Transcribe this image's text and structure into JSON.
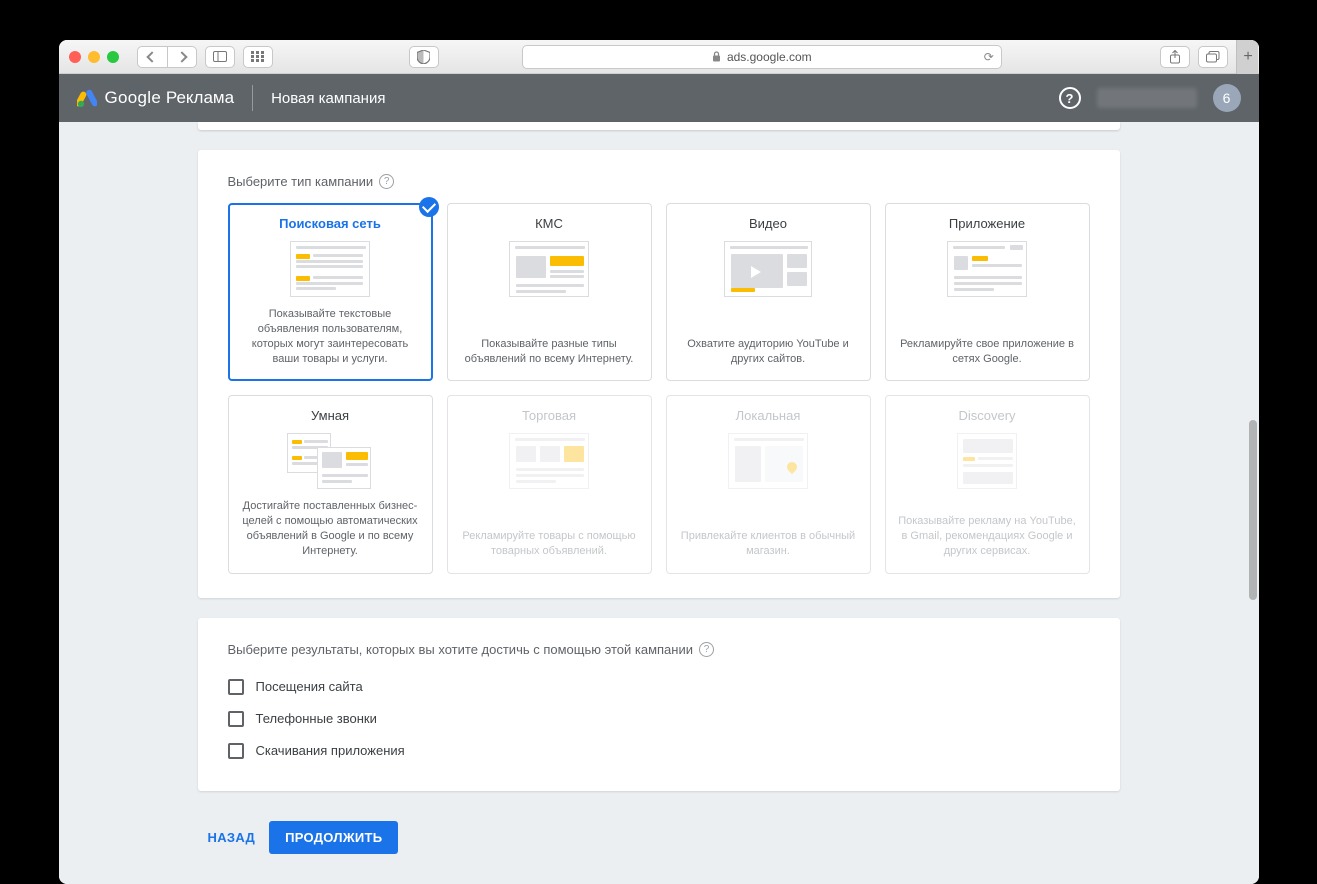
{
  "browser": {
    "url": "ads.google.com"
  },
  "header": {
    "brand": "Google",
    "brand_sub": "Реклама",
    "page": "Новая кампания",
    "avatar": "6"
  },
  "campaign_types": {
    "label": "Выберите тип кампании",
    "items": [
      {
        "title": "Поисковая сеть",
        "desc": "Показывайте текстовые объявления пользователям, которых могут заинтересовать ваши товары и услуги."
      },
      {
        "title": "КМС",
        "desc": "Показывайте разные типы объявлений по всему Интернету."
      },
      {
        "title": "Видео",
        "desc": "Охватите аудиторию YouTube и других сайтов."
      },
      {
        "title": "Приложение",
        "desc": "Рекламируйте свое приложение в сетях Google."
      },
      {
        "title": "Умная",
        "desc": "Достигайте поставленных бизнес-целей с помощью автоматических объявлений в Google и по всему Интернету."
      },
      {
        "title": "Торговая",
        "desc": "Рекламируйте товары с помощью товарных объявлений."
      },
      {
        "title": "Локальная",
        "desc": "Привлекайте клиентов в обычный магазин."
      },
      {
        "title": "Discovery",
        "desc": "Показывайте рекламу на YouTube, в Gmail, рекомендациях Google и других сервисах."
      }
    ]
  },
  "results": {
    "label": "Выберите результаты, которых вы хотите достичь с помощью этой кампании",
    "items": [
      {
        "label": "Посещения сайта"
      },
      {
        "label": "Телефонные звонки"
      },
      {
        "label": "Скачивания приложения"
      }
    ]
  },
  "footer": {
    "back": "НАЗАД",
    "continue": "ПРОДОЛЖИТЬ"
  }
}
